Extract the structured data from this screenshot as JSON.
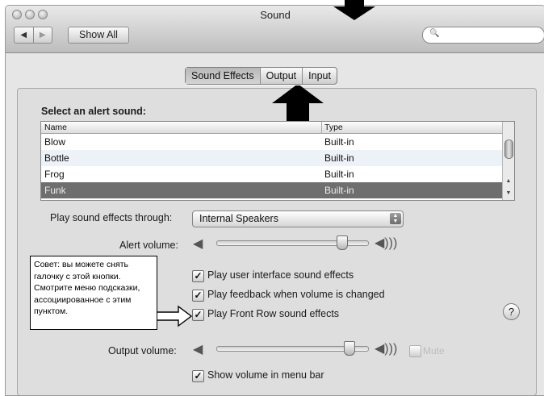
{
  "window": {
    "title": "Sound"
  },
  "toolbar": {
    "back_icon": "◀",
    "forward_icon": "▶",
    "show_all_label": "Show All",
    "search_icon": "🔍",
    "search_placeholder": ""
  },
  "tabs": [
    {
      "label": "Sound Effects",
      "selected": true
    },
    {
      "label": "Output",
      "selected": false
    },
    {
      "label": "Input",
      "selected": false
    }
  ],
  "alert": {
    "heading": "Select an alert sound:",
    "columns": [
      "Name",
      "Type"
    ],
    "rows": [
      {
        "name": "Blow",
        "type": "Built-in"
      },
      {
        "name": "Bottle",
        "type": "Built-in"
      },
      {
        "name": "Frog",
        "type": "Built-in"
      },
      {
        "name": "Funk",
        "type": "Built-in",
        "selected": true
      }
    ]
  },
  "play_through": {
    "label": "Play sound effects through:",
    "value": "Internal Speakers"
  },
  "alert_volume": {
    "label": "Alert volume:",
    "level": 0.85
  },
  "checkboxes": [
    {
      "label": "Play user interface sound effects",
      "checked": true
    },
    {
      "label": "Play feedback when volume is changed",
      "checked": true
    },
    {
      "label": "Play Front Row sound effects",
      "checked": true
    }
  ],
  "output_volume": {
    "label": "Output volume:",
    "level": 0.9,
    "mute_label": "Mute",
    "muted": false
  },
  "menu_bar_checkbox": {
    "label": "Show volume in menu bar",
    "checked": true
  },
  "help": {
    "label": "?"
  },
  "annotation": {
    "text": "Совет: вы можете снять\nгалочку с этой кнопки.\nСмотрите меню подсказки,\nассоциированное с этим\nпунктом."
  },
  "colors": {
    "selection": "#6e6e6e",
    "window_bg": "#e6e6e6",
    "arrow": "#000000"
  }
}
